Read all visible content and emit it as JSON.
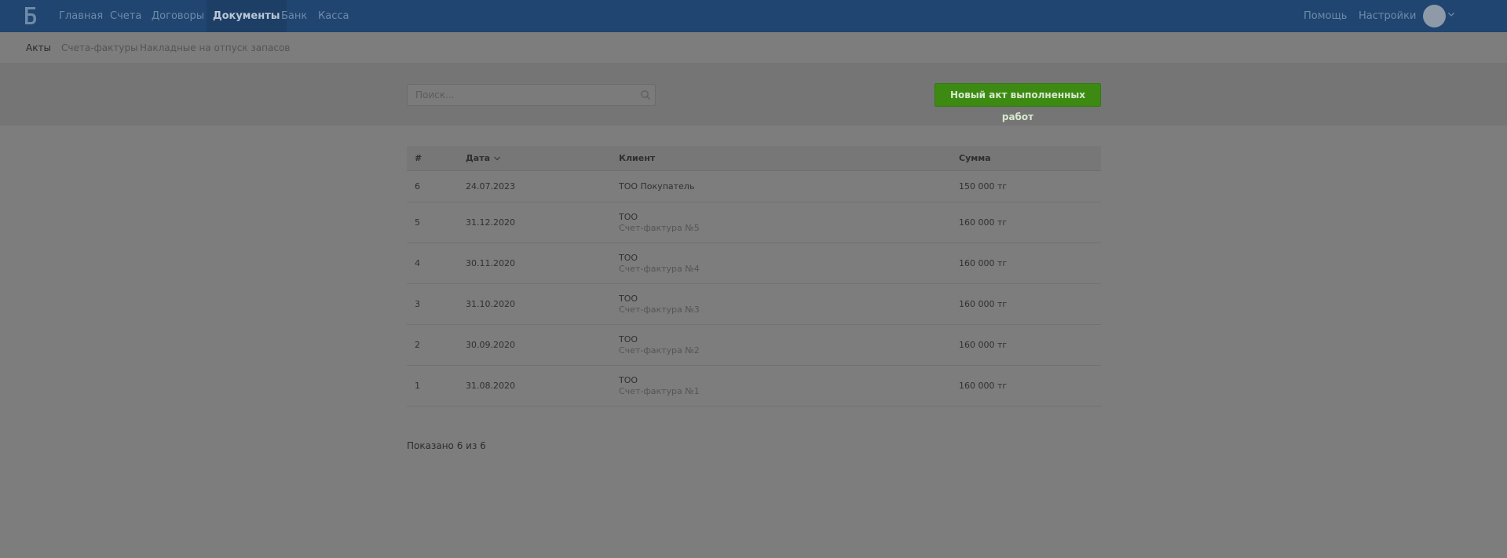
{
  "app": {
    "logo_icon": "b-letter-logo-icon"
  },
  "nav": {
    "items": [
      {
        "label": "Главная",
        "active": false
      },
      {
        "label": "Счета",
        "active": false
      },
      {
        "label": "Договоры",
        "active": false
      },
      {
        "label": "Документы",
        "active": true
      },
      {
        "label": "Банк",
        "active": false
      },
      {
        "label": "Касса",
        "active": false
      }
    ],
    "right": [
      {
        "label": "Помощь"
      },
      {
        "label": "Настройки"
      }
    ]
  },
  "subnav": {
    "items": [
      {
        "label": "Акты",
        "active": true
      },
      {
        "label": "Счета-фактуры",
        "active": false
      },
      {
        "label": "Накладные на отпуск запасов",
        "active": false
      }
    ]
  },
  "search": {
    "placeholder": "Поиск...",
    "value": ""
  },
  "toolbar": {
    "new_label": "Новый акт выполненных работ"
  },
  "table": {
    "columns": [
      "#",
      "Дата",
      "Клиент",
      "Сумма"
    ],
    "rows": [
      {
        "num": "6",
        "date": "24.07.2023",
        "client": "ТОО Покупатель",
        "sub": "",
        "sum": "150 000 тг"
      },
      {
        "num": "5",
        "date": "31.12.2020",
        "client": "ТОО",
        "sub": "Счет-фактура №5",
        "sum": "160 000 тг"
      },
      {
        "num": "4",
        "date": "30.11.2020",
        "client": "ТОО",
        "sub": "Счет-фактура №4",
        "sum": "160 000 тг"
      },
      {
        "num": "3",
        "date": "31.10.2020",
        "client": "ТОО",
        "sub": "Счет-фактура №3",
        "sum": "160 000 тг"
      },
      {
        "num": "2",
        "date": "30.09.2020",
        "client": "ТОО",
        "sub": "Счет-фактура №2",
        "sum": "160 000 тг"
      },
      {
        "num": "1",
        "date": "31.08.2020",
        "client": "ТОО",
        "sub": "Счет-фактура №1",
        "sum": "160 000 тг"
      }
    ]
  },
  "footer": {
    "count_text": "Показано 6 из 6"
  },
  "colors": {
    "topbar": "#1f4570",
    "accent_green": "#3c8a12",
    "overlay_bg": "#7d7d7d"
  }
}
